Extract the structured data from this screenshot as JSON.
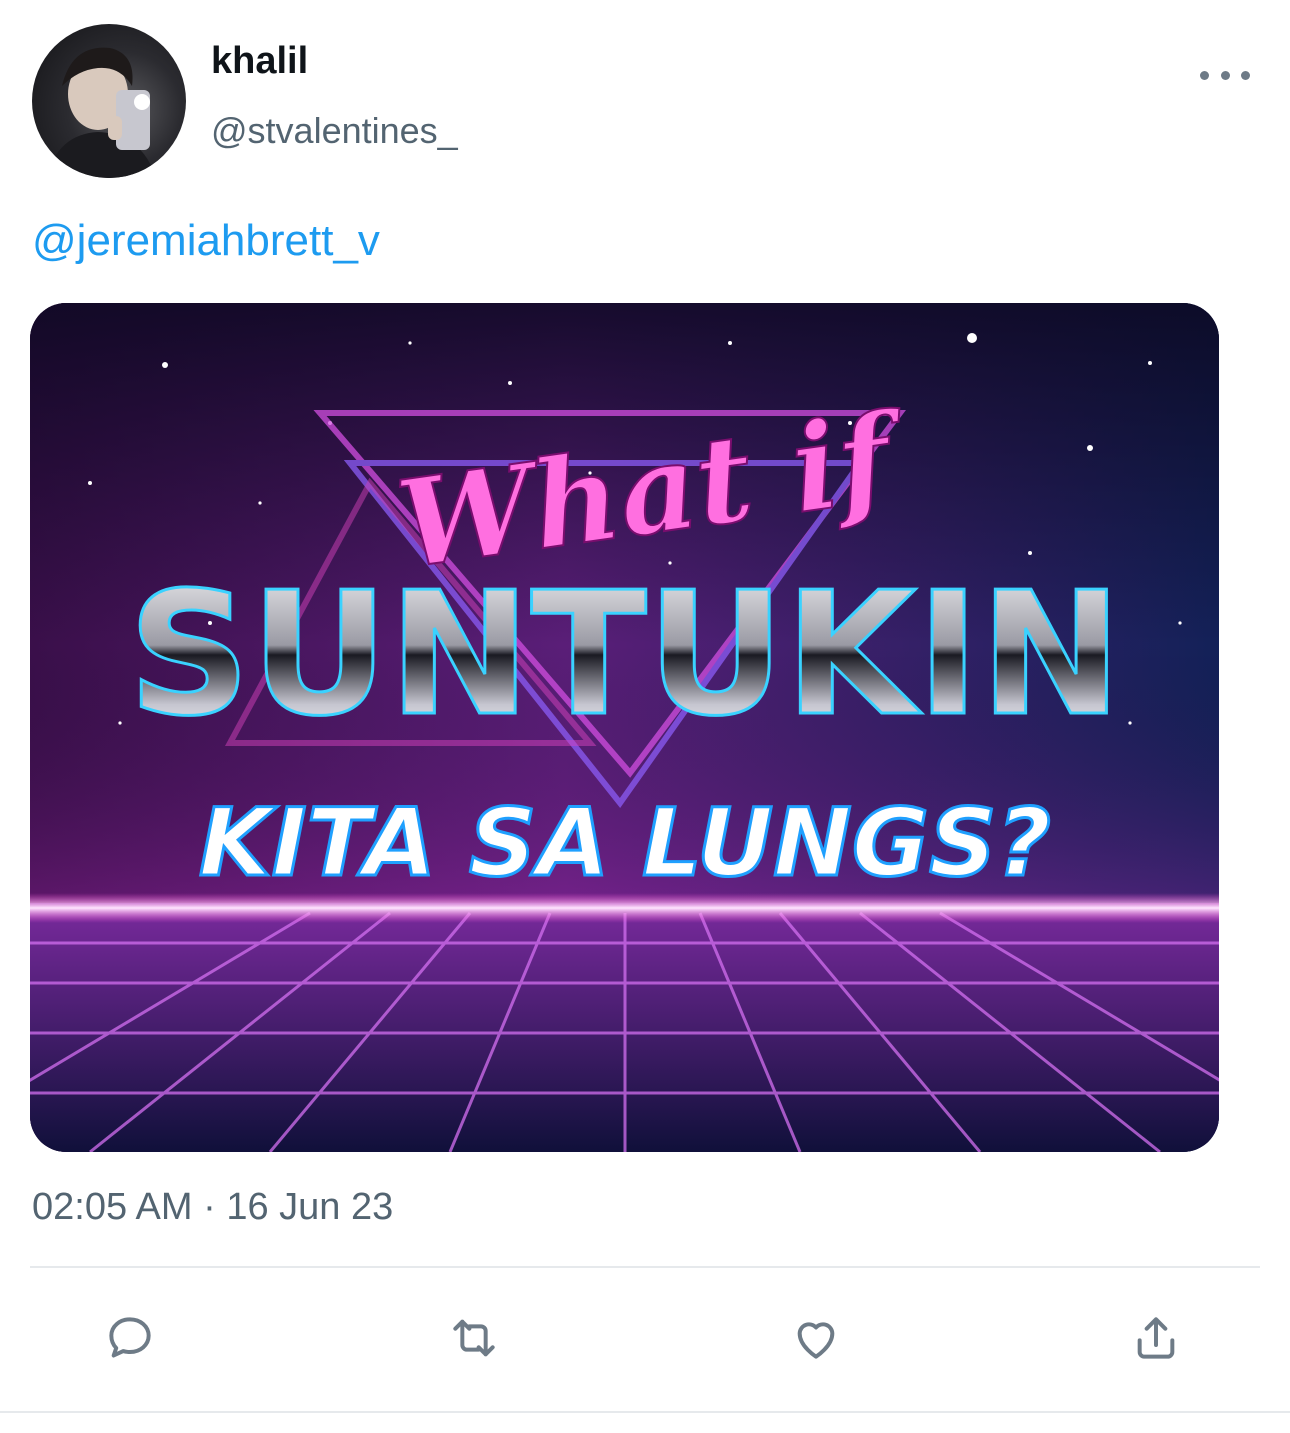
{
  "tweet": {
    "display_name": "khalil",
    "handle": "@stvalentines_",
    "mention": "@jeremiahbrett_v",
    "timestamp": "02:05 AM · 16 Jun 23",
    "avatar_icon": "avatar-photo"
  },
  "media": {
    "line1": "What if",
    "line2": "SUNTUKIN",
    "line3": "KITA SA LUNGS?"
  },
  "actions": [
    {
      "name": "reply",
      "icon": "comment-icon"
    },
    {
      "name": "retweet",
      "icon": "retweet-icon"
    },
    {
      "name": "like",
      "icon": "heart-icon"
    },
    {
      "name": "share",
      "icon": "share-icon"
    }
  ],
  "colors": {
    "link": "#1d9bf0",
    "secondary_text": "#536471",
    "icon": "#6e7b87"
  }
}
